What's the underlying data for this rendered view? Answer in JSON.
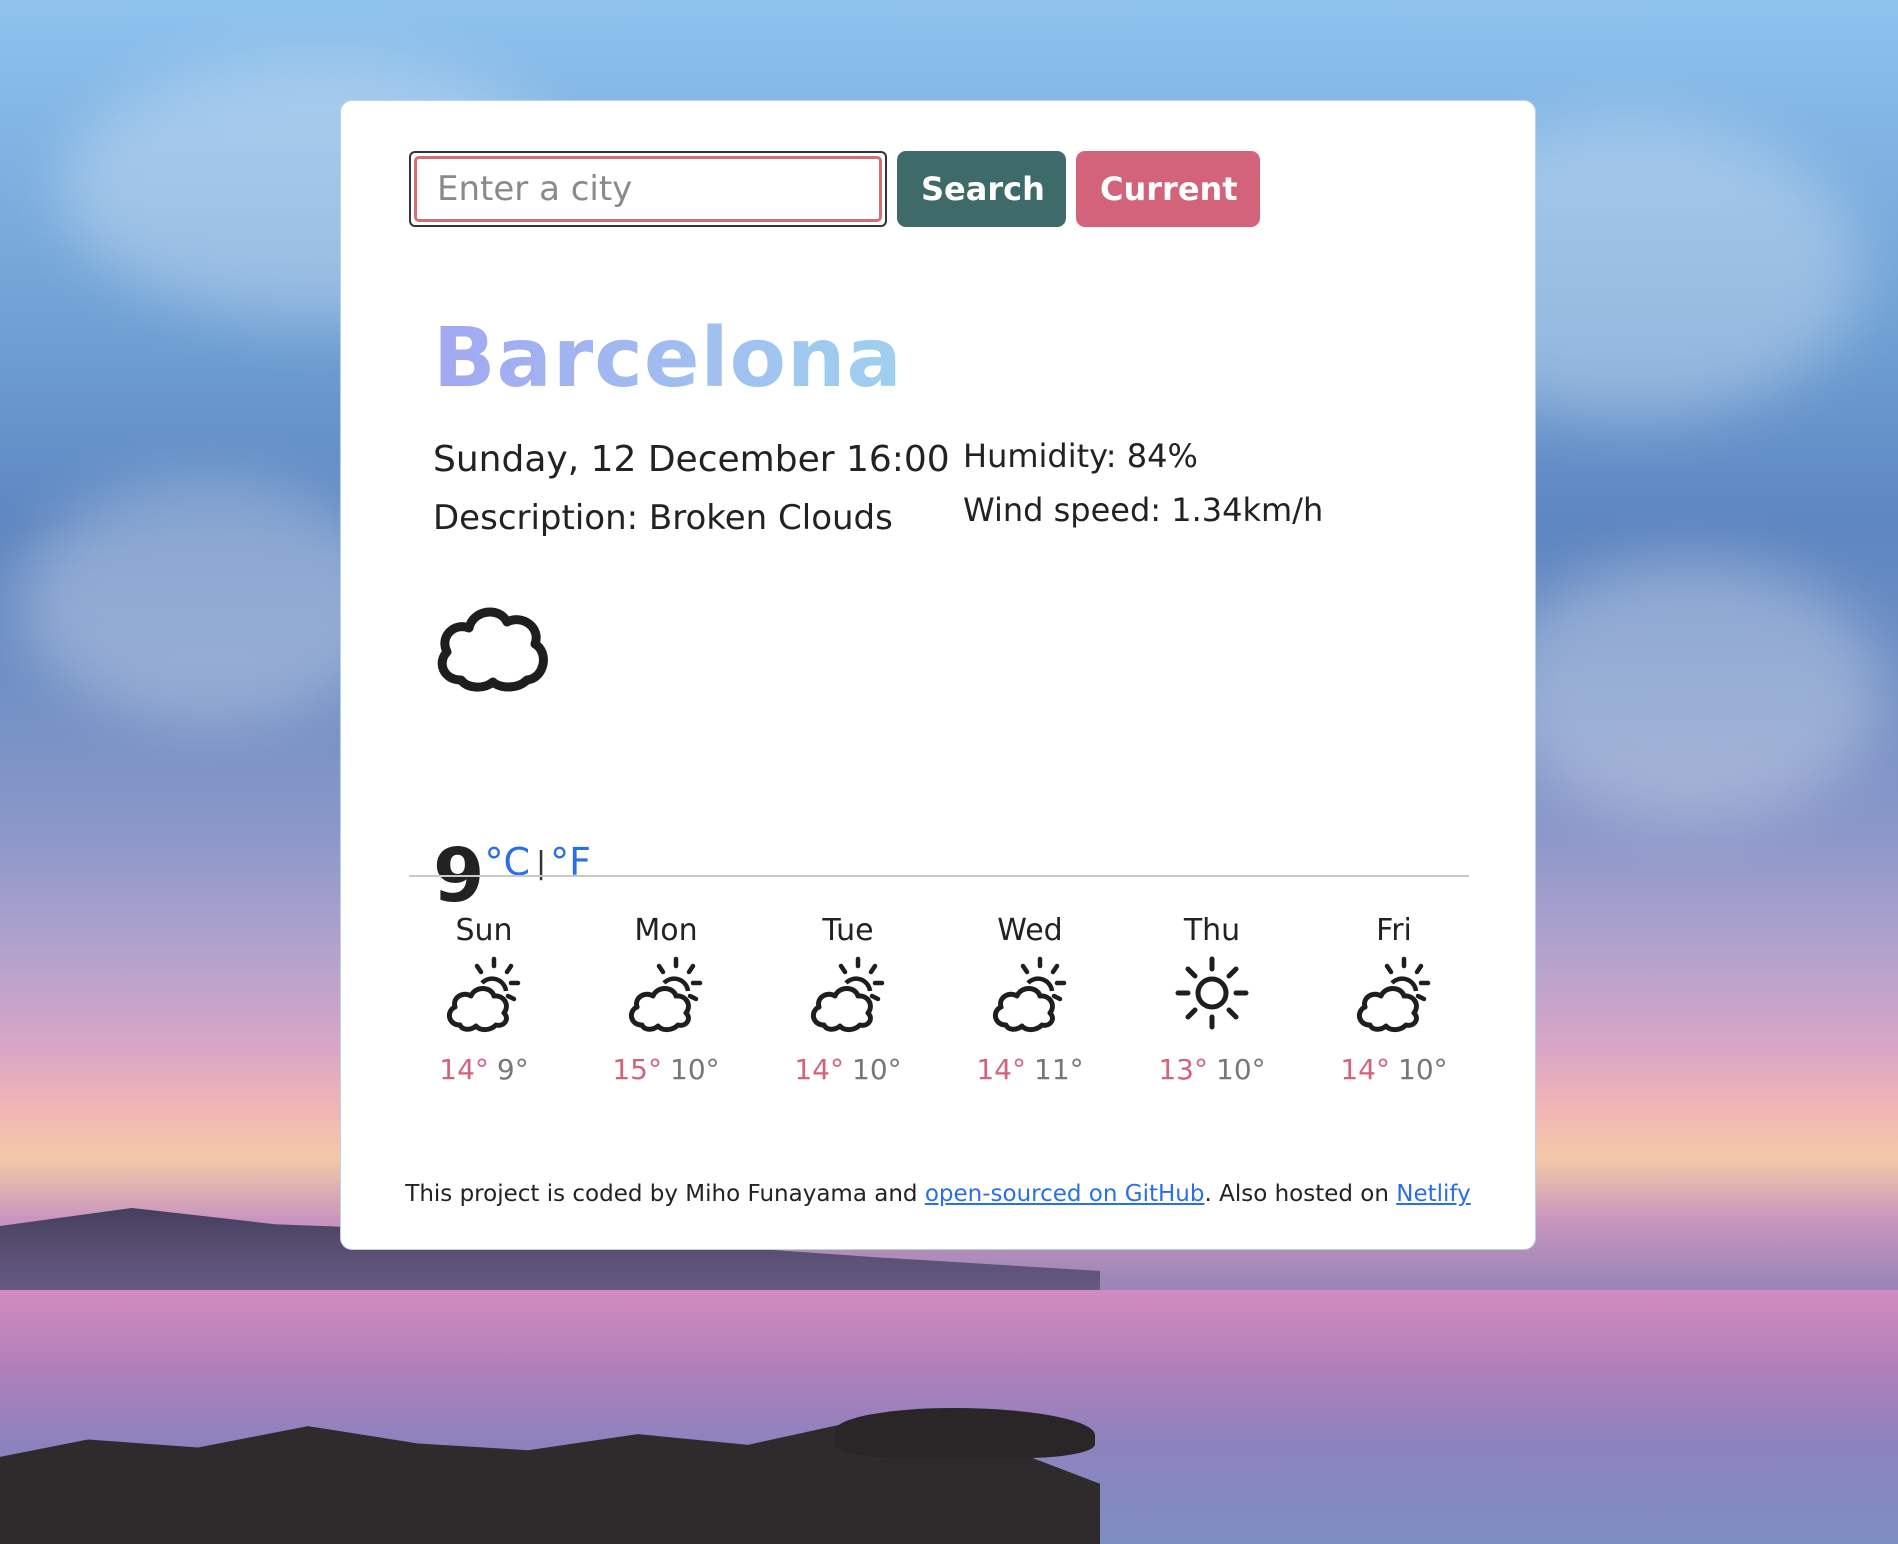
{
  "search": {
    "placeholder": "Enter a city",
    "search_label": "Search",
    "current_label": "Current"
  },
  "weather": {
    "city": "Barcelona",
    "date": "Sunday, 12 December 16:00",
    "description": "Description: Broken Clouds",
    "humidity": "Humidity: 84%",
    "wind": "Wind speed: 1.34km/h",
    "icon": "broken-clouds-icon",
    "temperature": "9",
    "unit_c": "°C",
    "unit_sep": "|",
    "unit_f": "°F"
  },
  "forecast": [
    {
      "day": "Sun",
      "icon": "partly-sunny-icon",
      "max": "14°",
      "min": "9°"
    },
    {
      "day": "Mon",
      "icon": "partly-sunny-icon",
      "max": "15°",
      "min": "10°"
    },
    {
      "day": "Tue",
      "icon": "partly-sunny-icon",
      "max": "14°",
      "min": "10°"
    },
    {
      "day": "Wed",
      "icon": "partly-sunny-icon",
      "max": "14°",
      "min": "11°"
    },
    {
      "day": "Thu",
      "icon": "sun-icon",
      "max": "13°",
      "min": "10°"
    },
    {
      "day": "Fri",
      "icon": "partly-sunny-icon",
      "max": "14°",
      "min": "10°"
    }
  ],
  "footer": {
    "text_before": "This project is coded by Miho Funayama and ",
    "github_link": "open-sourced on GitHub",
    "text_middle": ". Also hosted on ",
    "netlify_link": "Netlify"
  },
  "colors": {
    "search_button": "#3e6b6a",
    "current_button": "#d3637a",
    "max_temp": "#d3637a",
    "link": "#2a6fe8"
  }
}
